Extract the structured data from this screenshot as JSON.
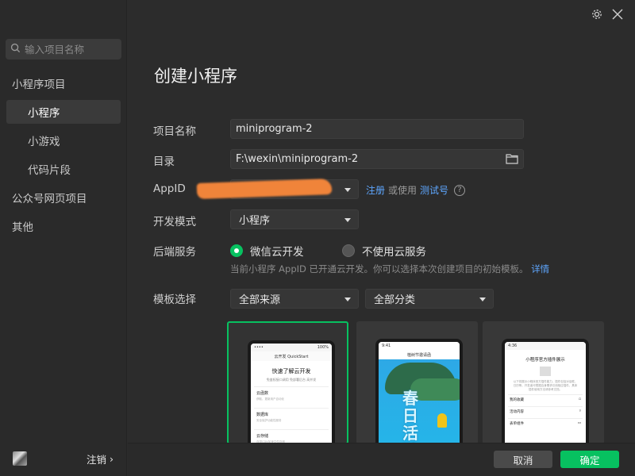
{
  "sidebar": {
    "search_placeholder": "输入项目名称",
    "items": [
      {
        "label": "小程序项目"
      },
      {
        "label": "小程序"
      },
      {
        "label": "小游戏"
      },
      {
        "label": "代码片段"
      },
      {
        "label": "公众号网页项目"
      },
      {
        "label": "其他"
      }
    ],
    "logout_label": "注销",
    "logout_chevron": "›"
  },
  "main": {
    "title": "创建小程序",
    "project_name": {
      "label": "项目名称",
      "value": "miniprogram-2"
    },
    "directory": {
      "label": "目录",
      "value": "F:\\wexin\\miniprogram-2"
    },
    "appid": {
      "label": "AppID",
      "register_link": "注册",
      "or_use": "或使用",
      "test_link": "测试号",
      "help": "?"
    },
    "dev_mode": {
      "label": "开发模式",
      "value": "小程序"
    },
    "backend": {
      "label": "后端服务",
      "options": [
        "微信云开发",
        "不使用云服务"
      ],
      "selected": 0,
      "hint": "当前小程序 AppID 已开通云开发。你可以选择本次创建项目的初始模板。",
      "hint_link": "详情"
    },
    "template": {
      "label": "模板选择",
      "source": "全部来源",
      "category": "全部分类",
      "cards": [
        {
          "status_left": "•••• ",
          "status_right": "100%",
          "header": "云开发 QuickStart",
          "heading": "快速了解云开发",
          "sub": "免鉴权接口调用 免部署后台 高并发",
          "rows": [
            {
              "t": "云函数",
              "d": "获取、更新用户自动化"
            },
            {
              "t": "数据库",
              "d": "安全保护功能性服务"
            },
            {
              "t": "云存储",
              "d": "自带CDN加速文件存储"
            }
          ]
        },
        {
          "status_left": "9:41",
          "status_right": "",
          "header": "植树节邀请函",
          "big": "春日活动"
        },
        {
          "status_left": "4:36",
          "status_right": "",
          "header": "",
          "heading": "小程序官方插件展示",
          "desc": "以下将展示小程序官方插件能力，插件包括对话框、日历等，开发者可根据自身需求引用相应插件，具体插件使用方法请参考文档。",
          "rows": [
            "我的收藏",
            "活动内容",
            "表单组件"
          ]
        }
      ]
    }
  },
  "footer": {
    "cancel": "取消",
    "confirm": "确定"
  },
  "colors": {
    "accent": "#07c160",
    "link": "#5ea7ff",
    "bg": "#2c2c2c"
  }
}
